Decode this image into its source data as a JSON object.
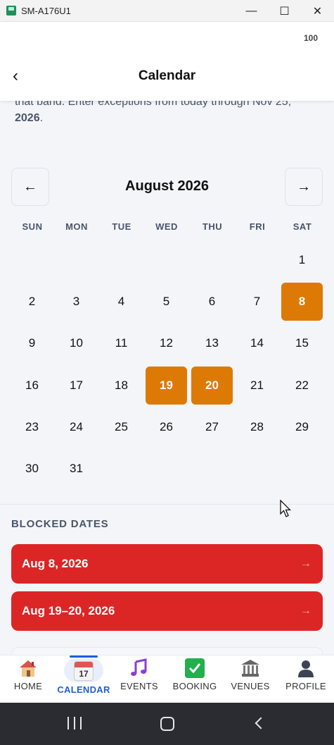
{
  "window": {
    "title": "SM-A176U1",
    "minimize_glyph": "—",
    "maximize_glyph": "☐",
    "close_glyph": "✕"
  },
  "status": {
    "battery": "100"
  },
  "header": {
    "back_glyph": "‹",
    "title": "Calendar"
  },
  "intro": {
    "line1": "that band. Enter exceptions from today through Nov 25,",
    "line2": "2026",
    "line2_suffix": "."
  },
  "calendar": {
    "prev_glyph": "←",
    "next_glyph": "→",
    "month_label": "August 2026",
    "weekdays": [
      "SUN",
      "MON",
      "TUE",
      "WED",
      "THU",
      "FRI",
      "SAT"
    ],
    "first_weekday_index": 6,
    "days_in_month": 31,
    "blocked_days": [
      8,
      19,
      20
    ],
    "colors": {
      "blocked": "#dd7a05"
    }
  },
  "blocked_section": {
    "title": "BLOCKED DATES",
    "items": [
      {
        "label": "Aug 8, 2026",
        "arrow": "→"
      },
      {
        "label": "Aug 19–20, 2026",
        "arrow": "→"
      }
    ],
    "colors": {
      "card": "#dc2626"
    }
  },
  "tabs": [
    {
      "label": "HOME",
      "icon": "house-icon",
      "active": false
    },
    {
      "label": "CALENDAR",
      "icon": "calendar-icon",
      "active": true,
      "icon_text": "17"
    },
    {
      "label": "EVENTS",
      "icon": "music-note-icon",
      "active": false
    },
    {
      "label": "BOOKING",
      "icon": "check-box-icon",
      "active": false
    },
    {
      "label": "VENUES",
      "icon": "classical-building-icon",
      "active": false
    },
    {
      "label": "PROFILE",
      "icon": "person-silhouette-icon",
      "active": false
    }
  ],
  "colors": {
    "accent": "#1d5fd6",
    "background": "#f3f5f9"
  }
}
